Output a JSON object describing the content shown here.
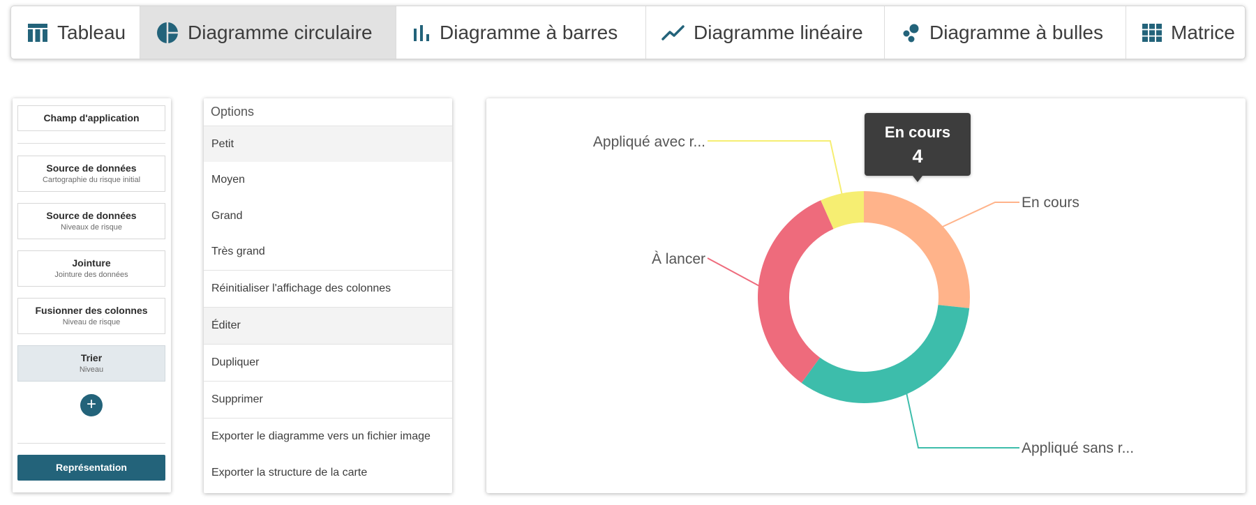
{
  "tabs": [
    {
      "label": "Tableau",
      "icon": "table-icon",
      "active": false
    },
    {
      "label": "Diagramme circulaire",
      "icon": "pie-chart-icon",
      "active": true
    },
    {
      "label": "Diagramme à barres",
      "icon": "bar-chart-icon",
      "active": false
    },
    {
      "label": "Diagramme linéaire",
      "icon": "line-chart-icon",
      "active": false
    },
    {
      "label": "Diagramme à bulles",
      "icon": "bubble-chart-icon",
      "active": false
    },
    {
      "label": "Matrice",
      "icon": "matrix-icon",
      "active": false
    }
  ],
  "steps": {
    "scope": {
      "title": "Champ d'application"
    },
    "items": [
      {
        "title": "Source de données",
        "subtitle": "Cartographie du risque initial"
      },
      {
        "title": "Source de données",
        "subtitle": "Niveaux de risque"
      },
      {
        "title": "Jointure",
        "subtitle": "Jointure des données"
      },
      {
        "title": "Fusionner des colonnes",
        "subtitle": "Niveau de risque"
      },
      {
        "title": "Trier",
        "subtitle": "Niveau"
      }
    ],
    "add_label": "+",
    "representation_label": "Représentation"
  },
  "menu": {
    "header": "Options",
    "items": [
      "Petit",
      "Moyen",
      "Grand",
      "Très grand",
      "Réinitialiser l'affichage des colonnes",
      "Éditer",
      "Dupliquer",
      "Supprimer",
      "Exporter le diagramme vers un fichier image",
      "Exporter la structure de la carte"
    ]
  },
  "colors": {
    "accent": "#23637a",
    "tab_icon": "#23637a",
    "en_cours": "#ffb38a",
    "applique_sans": "#3dbdab",
    "a_lancer": "#ee6b7c",
    "applique_avec": "#f6ee72",
    "tooltip_bg": "#3d3d3d"
  },
  "chart_data": {
    "type": "pie",
    "variant": "donut",
    "categories": [
      "En cours",
      "Appliqué sans r...",
      "À lancer",
      "Appliqué avec r..."
    ],
    "values": [
      4,
      5,
      5,
      1
    ],
    "labels": [
      "En cours",
      "Appliqué sans r...",
      "À lancer",
      "Appliqué avec r..."
    ],
    "tooltip": {
      "title": "En cours",
      "value": "4"
    }
  }
}
